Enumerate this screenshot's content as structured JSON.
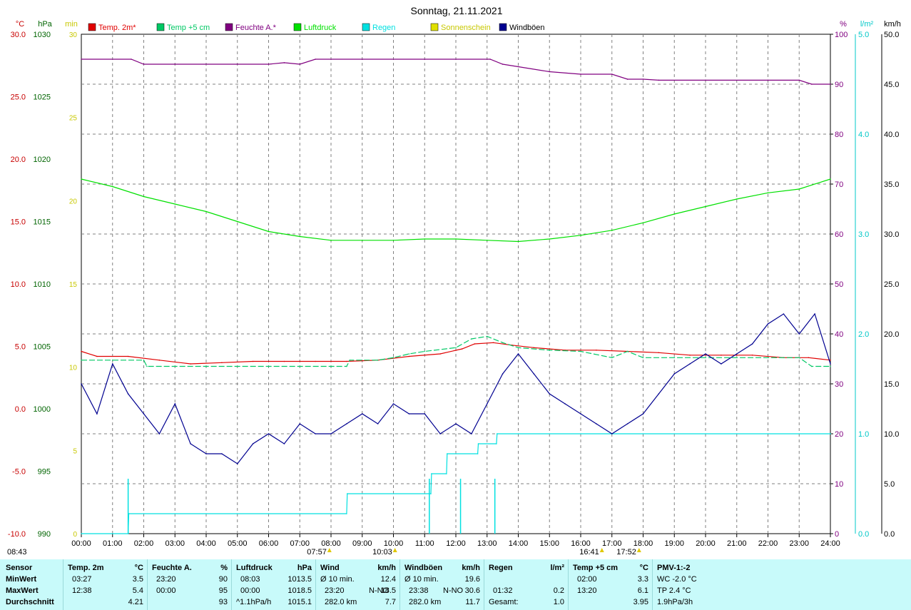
{
  "chart_data": {
    "type": "line",
    "title": "Sonntag, 21.11.2021",
    "x_ticks": [
      "00:00",
      "01:00",
      "02:00",
      "03:00",
      "04:00",
      "05:00",
      "06:00",
      "07:00",
      "08:00",
      "09:00",
      "10:00",
      "11:00",
      "12:00",
      "13:00",
      "14:00",
      "15:00",
      "16:00",
      "17:00",
      "18:00",
      "19:00",
      "20:00",
      "21:00",
      "22:00",
      "23:00",
      "24:00"
    ],
    "grid": true,
    "legend_placement": "top",
    "axes": {
      "temp": {
        "unit": "°C",
        "ticks": [
          "30.0",
          "25.0",
          "20.0",
          "15.0",
          "10.0",
          "5.0",
          "0.0",
          "-5.0",
          "-10.0"
        ],
        "range": [
          -10,
          30
        ],
        "color": "#c80000"
      },
      "pressure": {
        "unit": "hPa",
        "ticks": [
          "1030",
          "1025",
          "1020",
          "1015",
          "1010",
          "1005",
          "1000",
          "995",
          "990"
        ],
        "range": [
          990,
          1030
        ],
        "color": "#006400"
      },
      "sun": {
        "unit": "min",
        "ticks": [
          "30",
          "25",
          "20",
          "15",
          "10",
          "5",
          "0"
        ],
        "range": [
          0,
          30
        ],
        "color": "#c8c800"
      },
      "humidity": {
        "unit": "%",
        "ticks": [
          "100",
          "90",
          "80",
          "70",
          "60",
          "50",
          "40",
          "30",
          "20",
          "10",
          "0"
        ],
        "range": [
          0,
          100
        ],
        "color": "#800080"
      },
      "rain": {
        "unit": "l/m²",
        "ticks": [
          "5.0",
          "4.0",
          "3.0",
          "2.0",
          "1.0",
          "0.0"
        ],
        "range": [
          0,
          5
        ],
        "color": "#00c8c8"
      },
      "wind": {
        "unit": "km/h",
        "ticks": [
          "50.0",
          "45.0",
          "40.0",
          "35.0",
          "30.0",
          "25.0",
          "20.0",
          "15.0",
          "10.0",
          "5.0",
          "0.0"
        ],
        "range": [
          0,
          50
        ],
        "color": "#000000"
      }
    },
    "legend": [
      {
        "name": "Temp. 2m*",
        "color": "#e00000"
      },
      {
        "name": "Temp +5 cm",
        "color": "#00c864"
      },
      {
        "name": "Feuchte A.*",
        "color": "#800080"
      },
      {
        "name": "Luftdruck",
        "color": "#00e000"
      },
      {
        "name": "Regen",
        "color": "#00e0e0"
      },
      {
        "name": "Sonnenschein",
        "color": "#e0e000"
      },
      {
        "name": "Windböen",
        "color": "#000090"
      }
    ],
    "series": [
      {
        "name": "Temp. 2m*",
        "axis": "temp",
        "x": [
          0,
          0.5,
          1.5,
          2.5,
          3.5,
          4.5,
          5.5,
          6.5,
          7.5,
          8.5,
          9.5,
          10.5,
          11.5,
          12.2,
          12.6,
          13.2,
          13.8,
          14.5,
          15.5,
          16.5,
          17.5,
          18.5,
          19.5,
          20.5,
          21.5,
          22.5,
          23.3,
          24
        ],
        "y": [
          4.6,
          4.2,
          4.2,
          3.9,
          3.6,
          3.7,
          3.8,
          3.8,
          3.8,
          3.8,
          3.9,
          4.2,
          4.4,
          4.8,
          5.2,
          5.3,
          5.1,
          4.9,
          4.7,
          4.7,
          4.6,
          4.5,
          4.3,
          4.3,
          4.3,
          4.1,
          4.1,
          3.9
        ]
      },
      {
        "name": "Temp +5 cm",
        "axis": "temp",
        "x": [
          0,
          1,
          2,
          2.1,
          4,
          6,
          8,
          8.5,
          8.6,
          9.5,
          10,
          10.5,
          11,
          12,
          12.5,
          13,
          13.5,
          14,
          15,
          16,
          17,
          17.5,
          18,
          19,
          20,
          21,
          22,
          23,
          23.4,
          24
        ],
        "y": [
          3.9,
          3.9,
          3.9,
          3.4,
          3.4,
          3.4,
          3.4,
          3.4,
          3.9,
          3.9,
          4.1,
          4.4,
          4.6,
          4.9,
          5.6,
          5.8,
          5.3,
          4.9,
          4.7,
          4.6,
          4.1,
          4.6,
          4.1,
          4.1,
          4.1,
          4.1,
          4.1,
          4.1,
          3.4,
          3.4
        ]
      },
      {
        "name": "Feuchte A.*",
        "axis": "humidity",
        "x": [
          0,
          1.6,
          2,
          3,
          5,
          6,
          6.5,
          7,
          7.5,
          9,
          11,
          13.1,
          13.5,
          14,
          15,
          16,
          17,
          17.5,
          18,
          18.5,
          20,
          22,
          23,
          23.4,
          24
        ],
        "y": [
          95,
          95,
          94,
          94,
          94,
          94,
          94.3,
          94,
          95,
          95,
          95,
          95,
          94,
          93.5,
          92.5,
          92,
          92,
          91,
          91,
          90.8,
          90.8,
          90.8,
          90.8,
          90,
          90
        ]
      },
      {
        "name": "Luftdruck",
        "axis": "pressure",
        "x": [
          0,
          1,
          2,
          3,
          4,
          5,
          6,
          7,
          8,
          9,
          10,
          11,
          12,
          13,
          14,
          15,
          16,
          17,
          18,
          19,
          20,
          21,
          22,
          23,
          24
        ],
        "y": [
          1018.4,
          1017.8,
          1017.0,
          1016.4,
          1015.8,
          1015.0,
          1014.2,
          1013.8,
          1013.5,
          1013.5,
          1013.5,
          1013.6,
          1013.6,
          1013.5,
          1013.4,
          1013.6,
          1013.9,
          1014.3,
          1014.9,
          1015.6,
          1016.2,
          1016.8,
          1017.3,
          1017.6,
          1018.4
        ]
      },
      {
        "name": "Regen",
        "axis": "rain",
        "x": [
          0,
          1.5,
          1.52,
          8.5,
          8.52,
          11.2,
          11.22,
          11.7,
          11.72,
          12.7,
          12.72,
          13.3,
          13.32,
          24
        ],
        "y": [
          0,
          0,
          0.2,
          0.2,
          0.4,
          0.4,
          0.6,
          0.6,
          0.8,
          0.8,
          0.9,
          0.9,
          1.0,
          1.0
        ]
      },
      {
        "name": "Windböen",
        "axis": "wind",
        "x": [
          0,
          0.5,
          1,
          1.5,
          2,
          2.5,
          3,
          3.5,
          4,
          4.5,
          5,
          5.5,
          6,
          6.5,
          7,
          7.5,
          8,
          8.5,
          9,
          9.5,
          10,
          10.5,
          11,
          11.5,
          12,
          12.5,
          13,
          13.5,
          14,
          14.5,
          15,
          15.5,
          16,
          16.5,
          17,
          17.5,
          18,
          18.5,
          19,
          19.5,
          20,
          20.5,
          21,
          21.5,
          22,
          22.5,
          23,
          23.5,
          24
        ],
        "y": [
          15,
          12,
          17,
          14,
          12,
          10,
          13,
          9,
          8,
          8,
          7,
          9,
          10,
          9,
          11,
          10,
          10,
          11,
          12,
          11,
          13,
          12,
          12,
          10,
          11,
          10,
          13,
          16,
          18,
          16,
          14,
          13,
          12,
          11,
          10,
          11,
          12,
          14,
          16,
          17,
          18,
          17,
          18,
          19,
          21,
          22,
          20,
          22,
          17
        ]
      }
    ],
    "spikes": {
      "x": [
        1.5,
        11.15,
        12.15,
        13.25
      ],
      "axis": "rain"
    },
    "sun_markers": [
      {
        "hour": 7.95,
        "label": "07:57"
      },
      {
        "hour": 10.05,
        "label": "10:03"
      },
      {
        "hour": 16.68,
        "label": "16:41"
      },
      {
        "hour": 17.87,
        "label": "17:52"
      }
    ],
    "corner_label": "08:43"
  },
  "table": {
    "rows": [
      "Sensor",
      "MinWert",
      "MaxWert",
      "Durchschnitt"
    ],
    "temp2m": {
      "title": "Temp. 2m",
      "unit": "°C",
      "min_time": "03:27",
      "min": "3.5",
      "max_time": "12:38",
      "max": "5.4",
      "avg": "4.21"
    },
    "humidity": {
      "title": "Feuchte A.",
      "unit": "%",
      "min_time": "23:20",
      "min": "90",
      "max_time": "00:00",
      "max": "95",
      "avg": "93"
    },
    "pressure": {
      "title": "Luftdruck",
      "unit": "hPa",
      "min_time": "08:03",
      "min": "1013.5",
      "max_time": "00:00",
      "max": "1018.5",
      "avg_label": "^1.1hPa/h",
      "avg": "1015.1"
    },
    "wind": {
      "title": "Wind",
      "unit": "km/h",
      "min_label": "Ø 10 min.",
      "min": "12.4",
      "max_time": "23:20",
      "max_dir": "N-NO",
      "max": "18.5",
      "avg_label": "282.0 km",
      "avg": "7.7"
    },
    "gusts": {
      "title": "Windböen",
      "unit": "km/h",
      "min_label": "Ø 10 min.",
      "min": "19.6",
      "max_time": "23:38",
      "max_dir": "N-NO",
      "max": "30.6",
      "avg_label": "282.0 km",
      "avg": "11.7"
    },
    "rain": {
      "title": "Regen",
      "unit": "l/m²",
      "max_time": "01:32",
      "max": "0.2",
      "avg_label": "Gesamt:",
      "avg": "1.0"
    },
    "temp5cm": {
      "title": "Temp +5 cm",
      "unit": "°C",
      "min_time": "02:00",
      "min": "3.3",
      "max_time": "13:20",
      "max": "6.1",
      "avg": "3.95"
    },
    "pmv": {
      "title": "PMV-1:-2",
      "l1": "WC -2.0 °C",
      "l2": "TP 2.4 °C",
      "l3": "1.9hPa/3h"
    }
  }
}
